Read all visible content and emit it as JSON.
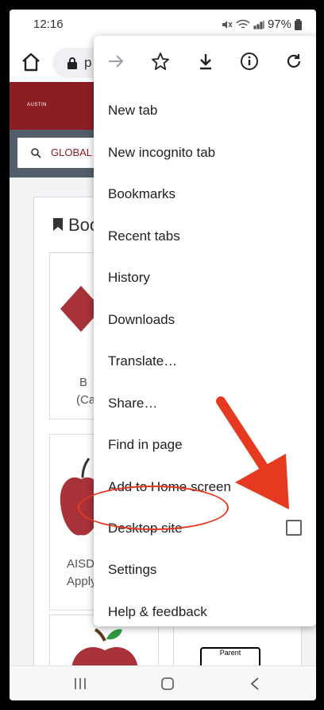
{
  "status": {
    "time": "12:16",
    "battery": "97%"
  },
  "urlbar": {
    "url_fragment": "p"
  },
  "page": {
    "search_text": "GLOBAL S",
    "logo_text": "AUSTIN",
    "bookmark_heading": "Boo",
    "tiles": [
      {
        "line1": "B",
        "line2": "(Ca"
      },
      {
        "line1": "AISD",
        "line2": "Apply"
      }
    ],
    "parent_sign": "Parent"
  },
  "menu": {
    "items": [
      {
        "label": "New tab"
      },
      {
        "label": "New incognito tab"
      },
      {
        "label": "Bookmarks"
      },
      {
        "label": "Recent tabs"
      },
      {
        "label": "History"
      },
      {
        "label": "Downloads"
      },
      {
        "label": "Translate…"
      },
      {
        "label": "Share…"
      },
      {
        "label": "Find in page"
      },
      {
        "label": "Add to Home screen"
      },
      {
        "label": "Desktop site"
      },
      {
        "label": "Settings"
      },
      {
        "label": "Help & feedback"
      }
    ],
    "toolbar_icons": [
      "forward-icon",
      "star-icon",
      "download-icon",
      "info-icon",
      "reload-icon"
    ]
  },
  "colors": {
    "brand": "#8c1d25",
    "annotation": "#e53a1f",
    "band": "#525e6a"
  }
}
